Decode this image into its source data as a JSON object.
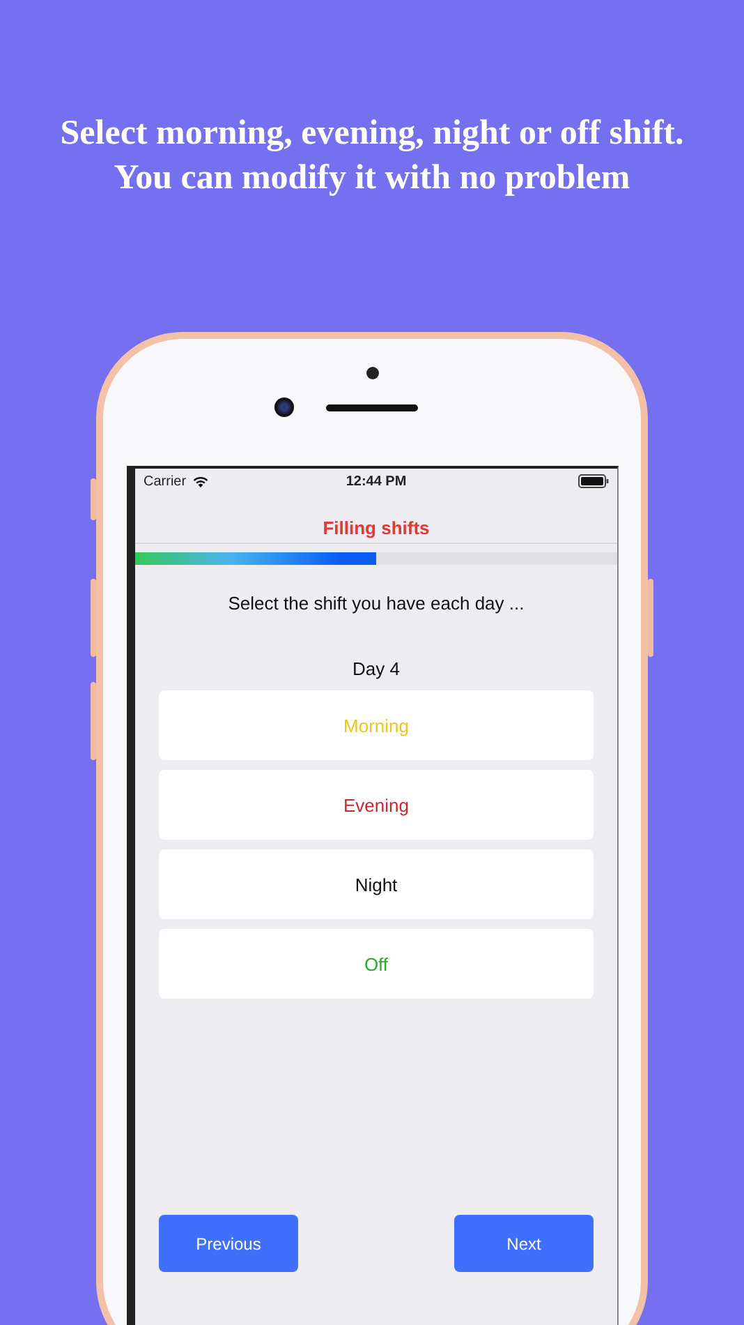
{
  "headline": [
    "Select morning, evening, night or off shift.",
    "You can modify it with no problem"
  ],
  "status_bar": {
    "carrier": "Carrier",
    "time": "12:44 PM"
  },
  "nav": {
    "title": "Filling shifts"
  },
  "progress": {
    "level": 0.5
  },
  "instruction": "Select the shift you have each day ...",
  "day": "Day 4",
  "options": [
    {
      "label": "Morning",
      "color": "#f0c419"
    },
    {
      "label": "Evening",
      "color": "#d0262b"
    },
    {
      "label": "Night",
      "color": "#111111"
    },
    {
      "label": "Off",
      "color": "#2bab2b"
    }
  ],
  "buttons": [
    "Previous",
    "Next"
  ]
}
